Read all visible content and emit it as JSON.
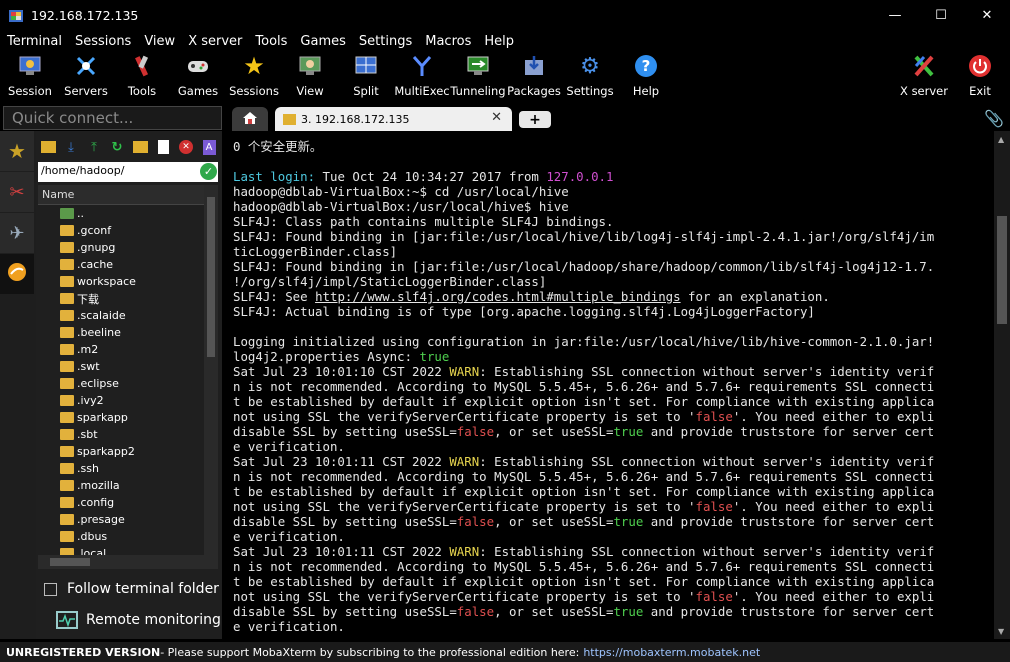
{
  "window": {
    "title": "192.168.172.135"
  },
  "menubar": [
    "Terminal",
    "Sessions",
    "View",
    "X server",
    "Tools",
    "Games",
    "Settings",
    "Macros",
    "Help"
  ],
  "toolbar": {
    "session": "Session",
    "servers": "Servers",
    "tools": "Tools",
    "games": "Games",
    "sessions": "Sessions",
    "view": "View",
    "split": "Split",
    "multiexec": "MultiExec",
    "tunneling": "Tunneling",
    "packages": "Packages",
    "settings": "Settings",
    "help": "Help",
    "xserver": "X server",
    "exit": "Exit"
  },
  "quick_connect": {
    "placeholder": "Quick connect..."
  },
  "tabs": {
    "session_label": "3. 192.168.172.135"
  },
  "sftp": {
    "path": "/home/hadoop/",
    "column": "Name",
    "files": [
      "..",
      ".gconf",
      ".gnupg",
      ".cache",
      "workspace",
      "下载",
      ".scalaide",
      ".beeline",
      ".m2",
      ".swt",
      ".eclipse",
      ".ivy2",
      "sparkapp",
      ".sbt",
      "sparkapp2",
      ".ssh",
      ".mozilla",
      ".config",
      ".presage",
      ".dbus",
      ".local"
    ],
    "follow_label": "Follow terminal folder",
    "remote_label": "Remote monitoring"
  },
  "terminal": {
    "l0": "0 个安全更新。",
    "l2a": "Last login: ",
    "l2b": "Tue Oct 24 10:34:27 2017 from ",
    "l2c": "127.0.0.1",
    "l3": "hadoop@dblab-VirtualBox:~$ cd /usr/local/hive",
    "l4": "hadoop@dblab-VirtualBox:/usr/local/hive$ hive",
    "l5": "SLF4J: Class path contains multiple SLF4J bindings.",
    "l6": "SLF4J: Found binding in [jar:file:/usr/local/hive/lib/log4j-slf4j-impl-2.4.1.jar!/org/slf4j/im",
    "l7": "ticLoggerBinder.class]",
    "l8": "SLF4J: Found binding in [jar:file:/usr/local/hadoop/share/hadoop/common/lib/slf4j-log4j12-1.7.",
    "l9": "!/org/slf4j/impl/StaticLoggerBinder.class]",
    "l10a": "SLF4J: See ",
    "l10b": "http://www.slf4j.org/codes.html#multiple_bindings",
    "l10c": " for an explanation.",
    "l11": "SLF4J: Actual binding is of type [org.apache.logging.slf4j.Log4jLoggerFactory]",
    "l13": "Logging initialized using configuration in jar:file:/usr/local/hive/lib/hive-common-2.1.0.jar!",
    "l14a": "log4j2.properties Async: ",
    "l14b": "true",
    "warn_time1": "Sat Jul 23 10:01:10 CST 2022 ",
    "warn_time2": "Sat Jul 23 10:01:11 CST 2022 ",
    "warn_time3": "Sat Jul 23 10:01:11 CST 2022 ",
    "warn": "WARN",
    "w1": ": Establishing SSL connection without server's identity verif",
    "w2": "n is not recommended. According to MySQL 5.5.45+, 5.6.26+ and 5.7.6+ requirements SSL connecti",
    "w3": "t be established by default if explicit option isn't set. For compliance with existing applica",
    "w4a": "not using SSL the verifyServerCertificate property is set to '",
    "w4b": "false",
    "w4c": "'. You need either to expli",
    "w5a": "disable SSL by setting useSSL=",
    "w5b": "false",
    "w5c": ", or set useSSL=",
    "w5d": "true",
    "w5e": " and provide truststore for server cert",
    "w6": "e verification."
  },
  "statusbar": {
    "bold": "UNREGISTERED VERSION",
    "text": " -  Please support MobaXterm by subscribing to the professional edition here:",
    "link": "https://mobaxterm.mobatek.net"
  }
}
